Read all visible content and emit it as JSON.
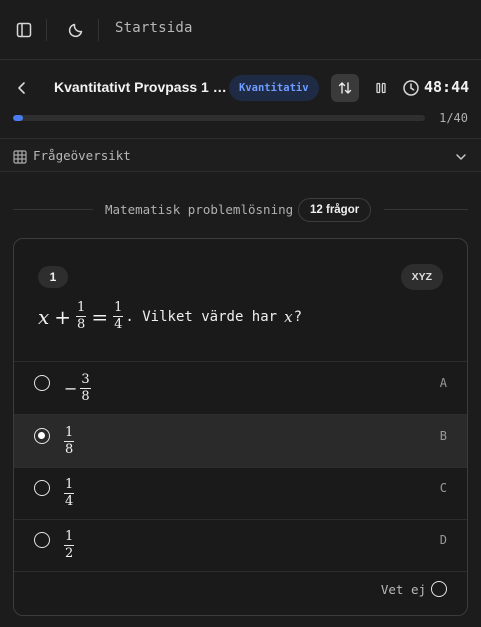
{
  "topbar": {
    "title": "Startsida"
  },
  "header": {
    "exam_title": "Kvantitativt Provpass 1 …",
    "badge": "Kvantitativ",
    "timer": "48:44"
  },
  "progress": {
    "text": "1/40",
    "fraction": 0.025
  },
  "overview": {
    "label": "Frågeöversikt"
  },
  "section": {
    "label": "Matematisk problemlösning",
    "badge": "12 frågor"
  },
  "question": {
    "number": "1",
    "tag": "XYZ",
    "lhs_var": "x",
    "plus": "+",
    "frac1": {
      "num": "1",
      "den": "8"
    },
    "equals": "=",
    "frac2": {
      "num": "1",
      "den": "4"
    },
    "text": ". Vilket värde har",
    "var": "x",
    "end": "?"
  },
  "options": [
    {
      "letter": "A",
      "sign": "−",
      "num": "3",
      "den": "8",
      "selected": false
    },
    {
      "letter": "B",
      "sign": "",
      "num": "1",
      "den": "8",
      "selected": true
    },
    {
      "letter": "C",
      "sign": "",
      "num": "1",
      "den": "4",
      "selected": false
    },
    {
      "letter": "D",
      "sign": "",
      "num": "1",
      "den": "2",
      "selected": false
    }
  ],
  "dont_know": {
    "label": "Vet ej"
  },
  "colors": {
    "accent": "#4a7cf0",
    "badge_text": "#6e9cff",
    "badge_bg": "#1f2a44",
    "background": "#1c1c1c"
  }
}
